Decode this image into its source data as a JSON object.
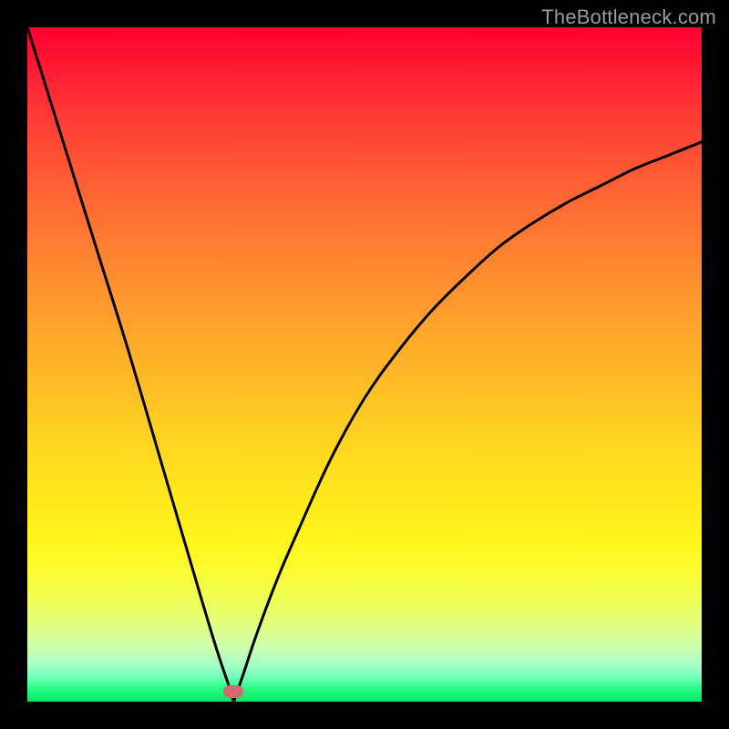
{
  "watermark": "TheBottleneck.com",
  "dot": {
    "x_pct": 30.6,
    "y_pct": 98.5,
    "color": "#cf6c72"
  },
  "chart_data": {
    "type": "line",
    "title": "",
    "xlabel": "",
    "ylabel": "",
    "xlim": [
      0,
      100
    ],
    "ylim": [
      0,
      100
    ],
    "grid": false,
    "legend": false,
    "background_gradient": {
      "top_color": "#ff0030",
      "bottom_color": "#00e764",
      "orientation": "vertical"
    },
    "annotations": [
      {
        "type": "marker",
        "x": 30.6,
        "y": 1.5,
        "shape": "pill",
        "color": "#cf6c72"
      }
    ],
    "series": [
      {
        "name": "left-branch",
        "x": [
          0,
          5,
          10,
          15,
          20,
          25,
          28,
          30,
          30.6
        ],
        "values": [
          100,
          84,
          68,
          52,
          35,
          18,
          8,
          2,
          0
        ]
      },
      {
        "name": "right-branch",
        "x": [
          30.6,
          32,
          34,
          37,
          40,
          45,
          50,
          55,
          60,
          65,
          70,
          75,
          80,
          85,
          90,
          95,
          100
        ],
        "values": [
          0,
          4,
          10,
          18,
          25,
          36,
          45,
          52,
          58,
          63,
          67.5,
          71,
          74,
          76.5,
          79,
          81,
          83
        ]
      }
    ]
  }
}
